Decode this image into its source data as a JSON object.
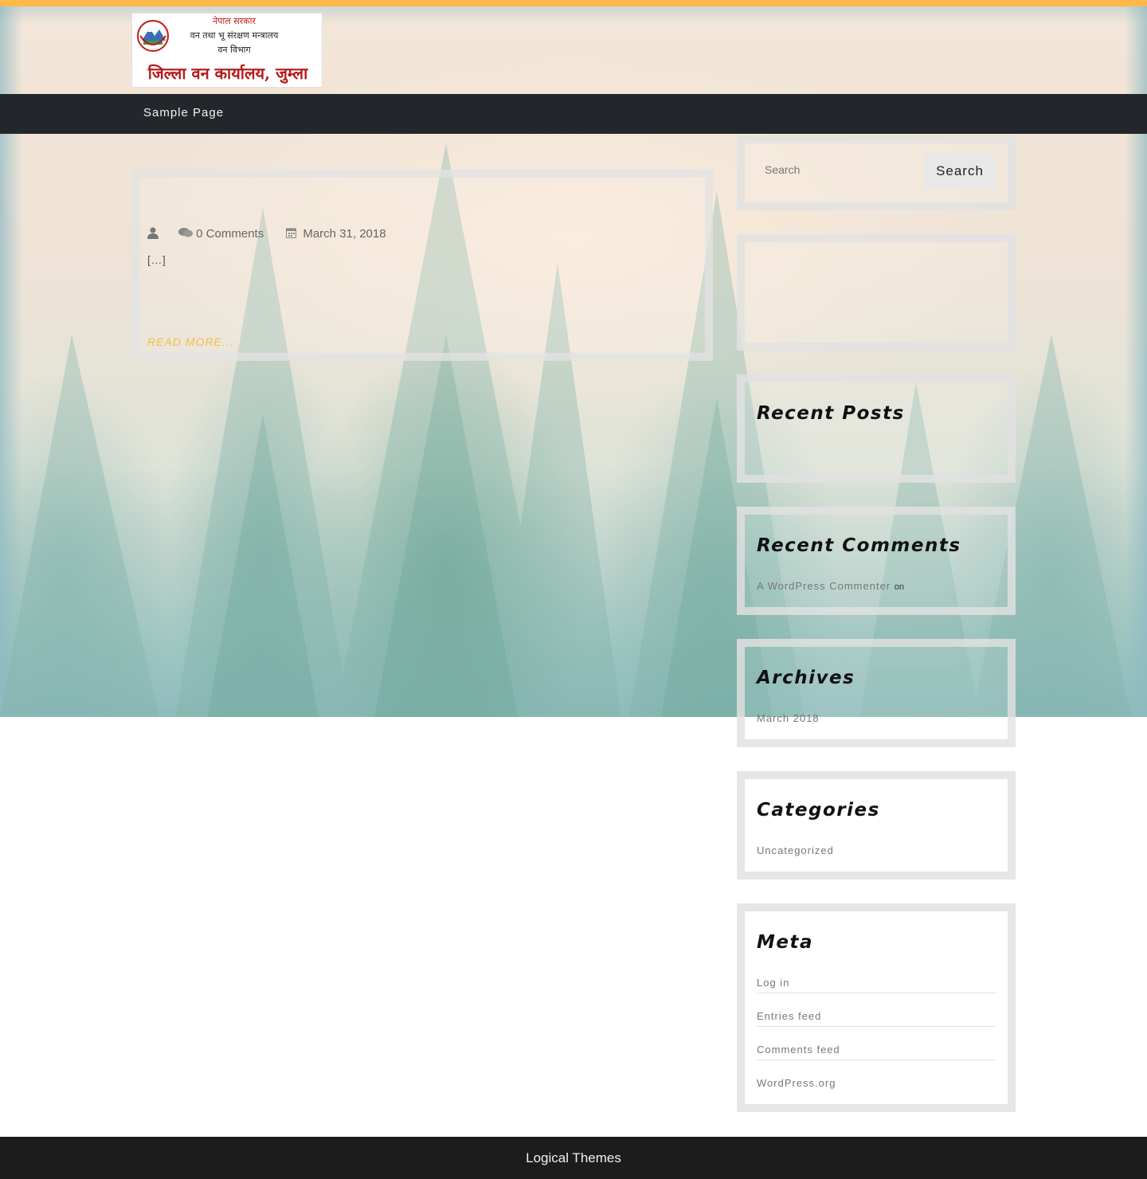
{
  "site": {
    "logo": {
      "line1": "नेपाल सरकार",
      "line2": "वन तथा भू संरक्षण मन्त्रालय",
      "line3": "वन विभाग",
      "line4": "जिल्ला वन कार्यालय, जुम्ला"
    },
    "accent_color": "#fdb94a"
  },
  "nav": {
    "items": [
      {
        "label": "Sample Page"
      }
    ]
  },
  "post": {
    "title": "",
    "comments": "0 Comments",
    "date": "March 31, 2018",
    "excerpt": "",
    "ellipsis": "[…]",
    "read_more": "READ MORE..."
  },
  "sidebar": {
    "search": {
      "placeholder": "Search",
      "button": "Search"
    },
    "widget1": {
      "title": "",
      "link": ""
    },
    "recent_posts": {
      "title": "Recent Posts",
      "items": [
        ""
      ]
    },
    "recent_comments": {
      "title": "Recent Comments",
      "author": "A WordPress Commenter",
      "on": "on",
      "post": ""
    },
    "archives": {
      "title": "Archives",
      "items": [
        "March 2018"
      ]
    },
    "categories": {
      "title": "Categories",
      "items": [
        "Uncategorized"
      ]
    },
    "meta": {
      "title": "Meta",
      "items": [
        "Log in",
        "Entries feed",
        "Comments feed",
        "WordPress.org"
      ]
    }
  },
  "footer": {
    "credit": "Logical Themes"
  }
}
